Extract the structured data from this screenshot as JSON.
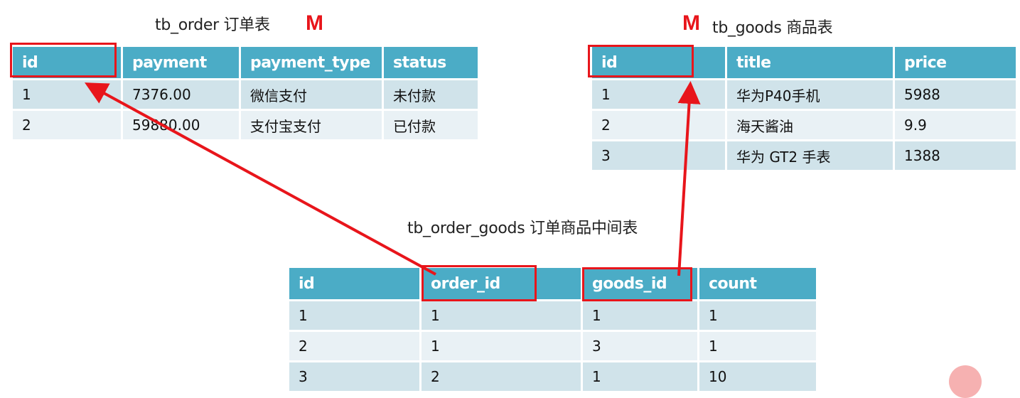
{
  "order_table": {
    "title": "tb_order 订单表",
    "marker": "M",
    "columns": [
      "id",
      "payment",
      "payment_type",
      "status"
    ],
    "rows": [
      [
        "1",
        "7376.00",
        "微信支付",
        "未付款"
      ],
      [
        "2",
        "59880.00",
        "支付宝支付",
        "已付款"
      ]
    ]
  },
  "goods_table": {
    "title": "tb_goods 商品表",
    "marker": "M",
    "columns": [
      "id",
      "title",
      "price"
    ],
    "rows": [
      [
        "1",
        "华为P40手机",
        "5988"
      ],
      [
        "2",
        "海天酱油",
        "9.9"
      ],
      [
        "3",
        "华为 GT2 手表",
        "1388"
      ]
    ]
  },
  "order_goods_table": {
    "title": "tb_order_goods 订单商品中间表",
    "columns": [
      "id",
      "order_id",
      "goods_id",
      "count"
    ],
    "rows": [
      [
        "1",
        "1",
        "1",
        "1"
      ],
      [
        "2",
        "1",
        "3",
        "1"
      ],
      [
        "3",
        "2",
        "1",
        "10"
      ]
    ]
  },
  "relations": [
    {
      "from": "tb_order_goods.order_id",
      "to": "tb_order.id"
    },
    {
      "from": "tb_order_goods.goods_id",
      "to": "tb_goods.id"
    }
  ],
  "colors": {
    "header": "#4bacc6",
    "row_odd": "#d0e3ea",
    "row_even": "#e9f1f5",
    "highlight": "#e8151b"
  }
}
